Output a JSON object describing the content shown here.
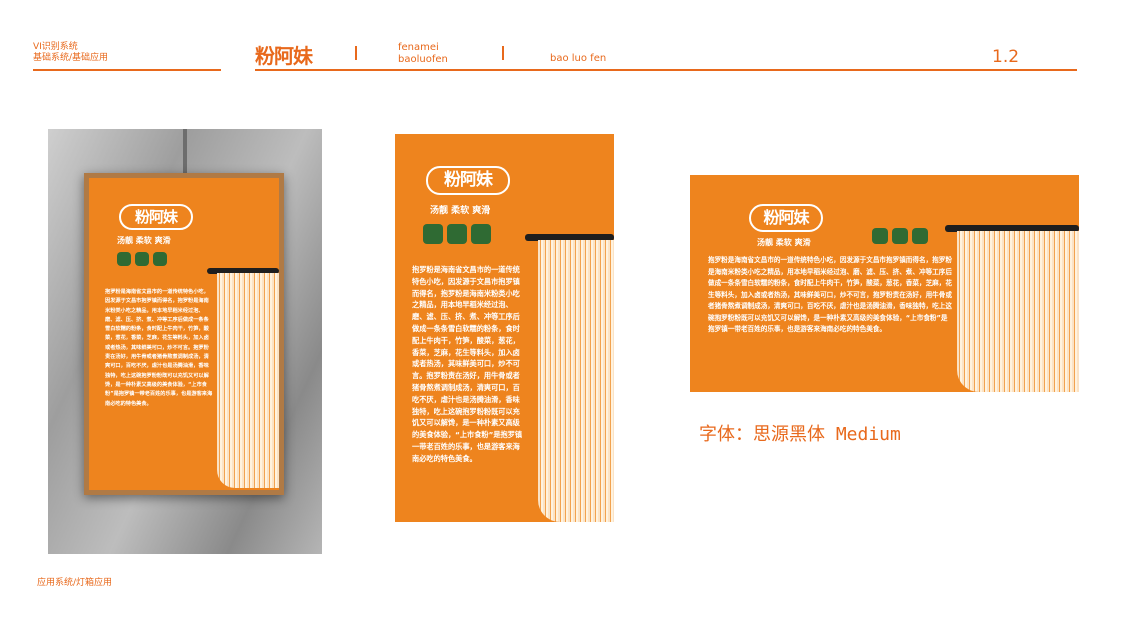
{
  "header": {
    "section_line1": "VI识别系统",
    "section_line2": "基础系统/基础应用",
    "logo": "粉阿妹",
    "brand_line1": "fenamei",
    "brand_line2": "baoluofen",
    "brand_line3": "bao luo fen",
    "page_number": "1.2"
  },
  "panel": {
    "logo": "粉阿妹",
    "tagline": "汤靓  柔软  爽滑",
    "icons": [
      "bowl-icon",
      "cup-icon",
      "chopsticks-icon"
    ],
    "body_vertical": "抱罗粉是海南省文昌市的一道传统特色小吃，因发源于文昌市抱罗镇而得名，抱罗粉是海南米粉类小吃之精品，用本地早稻米经过泡、磨、滤、压、挤、煮、冲等工序后做成一条条雪白软糯的粉条，食时配上牛肉干，竹笋，酸菜，葱花，香菜，芝麻，花生等料头，加入卤或者热汤，其味鲜美可口，炒不可言。抱罗粉责在汤好，用牛骨或者猪骨熬煮调制成汤，清爽可口，百吃不厌，虐汁也是汤腾油滑，香味独特，吃上这碗抱罗粉粉既可以充饥又可以解馋，是一种朴素又高级的美食体验，“上市食粉”是抱罗镇一带老百姓的乐事，也是游客来海南必吃的特色美食。",
    "body_horizontal": "抱罗粉是海南省文昌市的一道传统特色小吃，因发源于文昌市抱罗镇而得名，抱罗粉是海南米粉类小吃之精品，用本地早稻米经过泡、磨、滤、压、挤、煮、冲等工序后做成一条条雪白软糯的粉条，食时配上牛肉干，竹笋，酸菜，葱花，香菜，芝麻，花生等料头，加入卤或者热汤，其味鲜美可口，炒不可言，抱罗粉责在汤好，用牛骨或者猪骨熬煮调制成汤，清爽可口，百吃不厌，虐汁也是汤腾油滑，香味独特，吃上这碗抱罗粉粉既可以充饥又可以解馋，是一种朴素又高级的美食体验，“上市食粉”是抱罗镇一带老百姓的乐事，也是游客来海南必吃的特色美食。"
  },
  "font_note": "字体：思源黑体  Medium",
  "footer": "应用系统/灯箱应用",
  "colors": {
    "brand_orange": "#ee841e",
    "text_orange": "#e8691c",
    "icon_green": "#2f6a33"
  }
}
